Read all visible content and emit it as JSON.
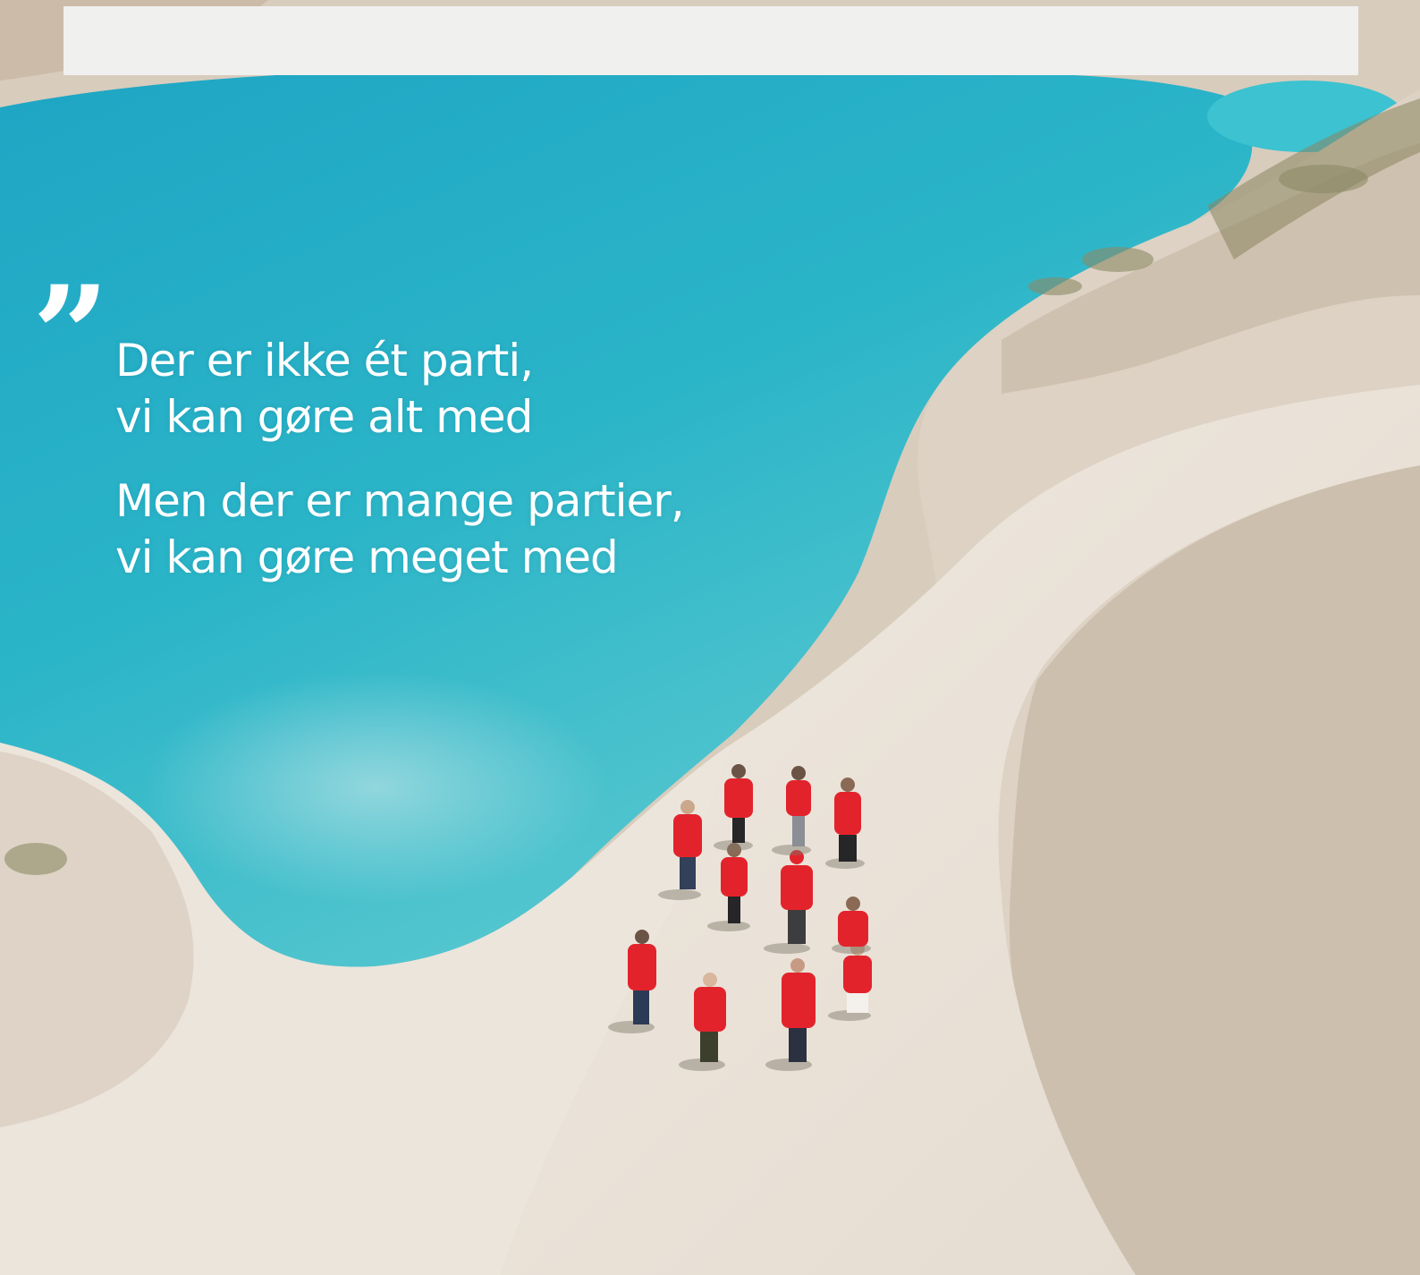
{
  "quote": {
    "mark": "”",
    "paragraphs": [
      {
        "line1": "Der er ikke ét parti,",
        "line2": "vi kan gøre alt med"
      },
      {
        "line1": "Men der er mange partier,",
        "line2": "vi kan gøre meget med"
      }
    ]
  },
  "colors": {
    "water": "#2fb6c6",
    "sand": "#e9e1d6",
    "jackets": "#e3232c",
    "top_bar": "#f0f0ef"
  }
}
